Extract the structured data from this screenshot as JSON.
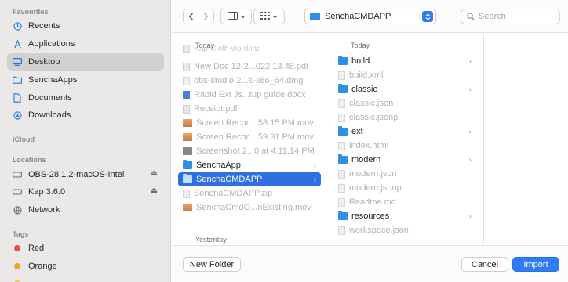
{
  "sidebar": {
    "favourites_header": "Favourites",
    "favourites": [
      {
        "label": "Recents",
        "icon": "clock-icon"
      },
      {
        "label": "Applications",
        "icon": "applications-icon"
      },
      {
        "label": "Desktop",
        "icon": "desktop-icon",
        "selected": true
      },
      {
        "label": "SenchaApps",
        "icon": "folder-icon"
      },
      {
        "label": "Documents",
        "icon": "document-icon"
      },
      {
        "label": "Downloads",
        "icon": "download-icon"
      }
    ],
    "icloud_header": "iCloud",
    "locations_header": "Locations",
    "locations": [
      {
        "label": "OBS-28.1.2-macOS-Intel",
        "icon": "disk-icon",
        "eject": true
      },
      {
        "label": "Kap 3.6.0",
        "icon": "disk-icon",
        "eject": true
      },
      {
        "label": "Network",
        "icon": "network-icon"
      }
    ],
    "tags_header": "Tags",
    "tags": [
      {
        "label": "Red",
        "color": "#f04a3e"
      },
      {
        "label": "Orange",
        "color": "#f7a12b"
      }
    ]
  },
  "toolbar": {
    "path_label": "SenchaCMDAPP",
    "search_placeholder": "Search"
  },
  "column1": {
    "header": "Today",
    "items": [
      {
        "label": "New Doc 12-2...022 13.48.pdf",
        "type": "pdf",
        "dim": true
      },
      {
        "label": "obs-studio-2...s-x86_64.dmg",
        "type": "doc",
        "dim": true
      },
      {
        "label": "Rapid Ext Js...tup guide.docx",
        "type": "docx",
        "dim": true
      },
      {
        "label": "Receipt.pdf",
        "type": "pdf",
        "dim": true
      },
      {
        "label": "Screen Recor....58.15 PM.mov",
        "type": "img",
        "dim": true
      },
      {
        "label": "Screen Recor....59.31 PM.mov",
        "type": "img",
        "dim": true
      },
      {
        "label": "Screenshot 2...0 at 4.11.14 PM",
        "type": "img-gray",
        "dim": true
      },
      {
        "label": "SenchaApp",
        "type": "folder",
        "chevron": true
      },
      {
        "label": "SenchaCMDAPP",
        "type": "folder",
        "chevron": true,
        "selected": true
      },
      {
        "label": "SenchaCMDAPP.zip",
        "type": "doc",
        "dim": true
      },
      {
        "label": "SenchaCmdO...nExisting.mov",
        "type": "img",
        "dim": true
      }
    ],
    "footer_header": "Yesterday"
  },
  "column2": {
    "header": "Today",
    "items": [
      {
        "label": "build",
        "type": "folder",
        "chevron": true
      },
      {
        "label": "build.xml",
        "type": "doc",
        "dim": true
      },
      {
        "label": "classic",
        "type": "folder",
        "chevron": true
      },
      {
        "label": "classic.json",
        "type": "doc",
        "dim": true
      },
      {
        "label": "classic.jsonp",
        "type": "doc",
        "dim": true
      },
      {
        "label": "ext",
        "type": "folder",
        "chevron": true
      },
      {
        "label": "index.html",
        "type": "doc",
        "dim": true
      },
      {
        "label": "modern",
        "type": "folder",
        "chevron": true
      },
      {
        "label": "modern.json",
        "type": "doc",
        "dim": true
      },
      {
        "label": "modern.jsonp",
        "type": "doc",
        "dim": true
      },
      {
        "label": "Readme.md",
        "type": "doc",
        "dim": true
      },
      {
        "label": "resources",
        "type": "folder",
        "chevron": true
      },
      {
        "label": "workspace.json",
        "type": "doc",
        "dim": true
      }
    ]
  },
  "bottom": {
    "new_folder": "New Folder",
    "cancel": "Cancel",
    "import": "Import"
  }
}
